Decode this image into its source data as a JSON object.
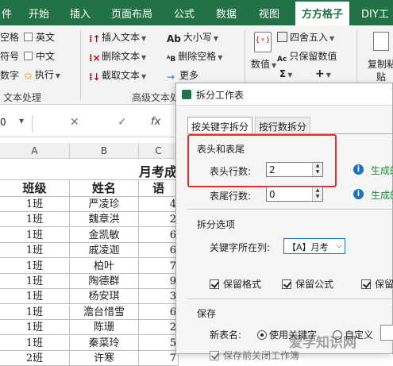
{
  "ribbon_tabs": [
    "件",
    "开始",
    "插入",
    "页面布局",
    "公式",
    "数据",
    "视图",
    "方方格子",
    "DIY工"
  ],
  "active_tab": "方方格子",
  "ribbon": {
    "left_partial": [
      "空格",
      "符号",
      "数字"
    ],
    "checkboxes": [
      "英文",
      "中文"
    ],
    "execute": "执行",
    "text_group_label": "文本处理",
    "col2": [
      "插入文本",
      "删除文本",
      "截取文本"
    ],
    "col3": [
      "大小写",
      "删除空格",
      "更多"
    ],
    "adv_group_label": "高级文本处",
    "numeric_label": "数值",
    "col5": [
      "四舍五入",
      "只保留数值"
    ],
    "copy_label": "复制粘",
    "copy_label2": "贴"
  },
  "formula_bar": {
    "namebox": "0",
    "cancel": "✕",
    "confirm": "✓",
    "fx": "fx"
  },
  "sheet": {
    "columns": [
      "A",
      "B",
      "C"
    ],
    "title_partial": "月考成",
    "headers": [
      "班级",
      "姓名",
      "语"
    ],
    "rows": [
      [
        "1班",
        "严凌珍",
        "4"
      ],
      [
        "1班",
        "魏章洪",
        "2"
      ],
      [
        "1班",
        "金凯敏",
        "6"
      ],
      [
        "1班",
        "戚凌迦",
        "6"
      ],
      [
        "1班",
        "柏叶",
        "7"
      ],
      [
        "1班",
        "陶德群",
        "9"
      ],
      [
        "1班",
        "杨安琪",
        "3"
      ],
      [
        "1班",
        "澹台惜雪",
        "6"
      ],
      [
        "1班",
        "陈珊",
        "2"
      ],
      [
        "1班",
        "秦菜玲",
        "5"
      ],
      [
        "2班",
        "许寒",
        "7"
      ]
    ]
  },
  "dialog": {
    "title": "拆分工作表",
    "tabs": [
      "按关键字拆分",
      "按行数拆分"
    ],
    "section_header": "表头和表尾",
    "header_rows_label": "表头行数:",
    "header_rows_value": "2",
    "footer_rows_label": "表尾行数:",
    "footer_rows_value": "0",
    "info_text_1": "生成的",
    "info_text_2": "生成的",
    "split_options": "拆分选项",
    "keyword_col_label": "关键字所在列:",
    "keyword_col_value": "【A】月考",
    "options": [
      "保留格式",
      "保留公式",
      "保留"
    ],
    "save_section": "保存",
    "new_name_label": "新表名:",
    "radio_1": "使用关键字",
    "radio_2": "自定义",
    "partial_bottom": "保存前关闭工作簿"
  },
  "watermark": "爱学知识网",
  "colors": {
    "ribbon_green": "#217346",
    "highlight_red": "#d9332c",
    "info_blue": "#1e73be",
    "info_green": "#1f8a3a"
  }
}
